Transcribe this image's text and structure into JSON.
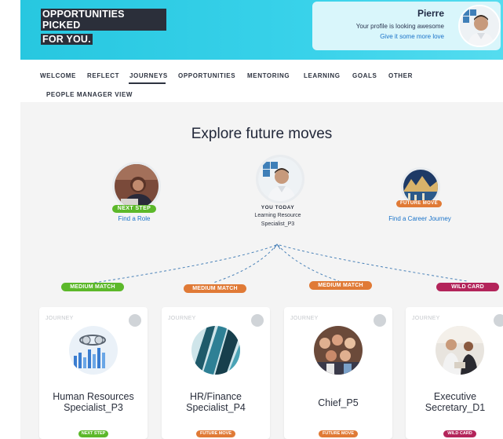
{
  "header": {
    "tagline_line1": "OPPORTUNITIES PICKED",
    "tagline_line2": "FOR YOU.",
    "profile_name": "Pierre",
    "profile_status": "Your profile is looking awesome",
    "profile_link": "Give it some more love"
  },
  "nav": {
    "items": [
      "WELCOME",
      "REFLECT",
      "JOURNEYS",
      "OPPORTUNITIES",
      "MENTORING",
      "LEARNING",
      "GOALS",
      "OTHER",
      "PEOPLE MANAGER VIEW"
    ],
    "active": "JOURNEYS"
  },
  "main": {
    "title": "Explore future moves",
    "next_step": {
      "badge": "NEXT STEP",
      "link": "Find a Role"
    },
    "you_today": {
      "label": "YOU TODAY",
      "role_line1": "Learning Resource",
      "role_line2": "Specialist_P3"
    },
    "future_move": {
      "badge": "FUTURE MOVE",
      "link": "Find a Career Journey"
    },
    "matches": [
      "MEDIUM MATCH",
      "MEDIUM MATCH",
      "MEDIUM MATCH",
      "WILD CARD"
    ],
    "cards": [
      {
        "tag": "JOURNEY",
        "title_line1": "Human Resources",
        "title_line2": "Specialist_P3",
        "badge": "NEXT STEP",
        "image": "data-chart-photo"
      },
      {
        "tag": "JOURNEY",
        "title_line1": "HR/Finance",
        "title_line2": "Specialist_P4",
        "badge": "FUTURE MOVE",
        "image": "glass-building-photo"
      },
      {
        "tag": "JOURNEY",
        "title_line1": "Chief_P5",
        "title_line2": "",
        "badge": "FUTURE MOVE",
        "image": "group-selfie-photo"
      },
      {
        "tag": "JOURNEY",
        "title_line1": "Executive",
        "title_line2": "Secretary_D1",
        "badge": "WILD CARD",
        "image": "meeting-photo"
      }
    ]
  },
  "colors": {
    "hero": "#33cfe7",
    "next_step": "#5cb82a",
    "future_move": "#e07a36",
    "wild_card": "#b3245a",
    "link": "#1a73c9"
  }
}
